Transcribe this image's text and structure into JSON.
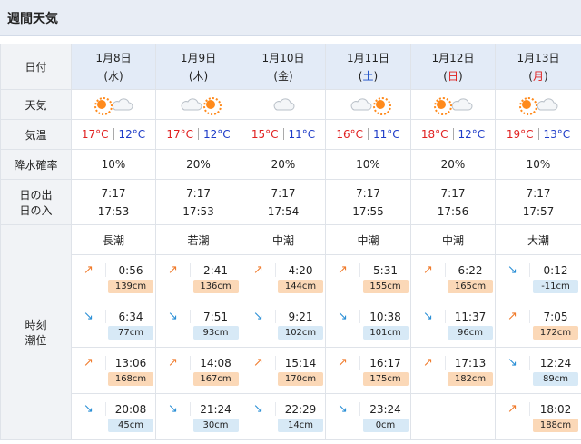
{
  "header": {
    "title": "週間天気"
  },
  "labels": {
    "date": "日付",
    "weather": "天気",
    "temperature": "気温",
    "precip": "降水確率",
    "sunrise": "日の出",
    "sunset": "日の入",
    "tide_time": "時刻",
    "tide_level": "潮位"
  },
  "colors": {
    "high_temp": "#e02020",
    "low_temp": "#1e3cc8",
    "rising": "#f07a2a",
    "falling": "#2a8fd6"
  },
  "days": [
    {
      "date": "1月8日",
      "weekday": "(水)",
      "weekday_type": "weekday",
      "icons": [
        "sun-icon",
        "cloud-icon"
      ],
      "high": "17°C",
      "low": "12°C",
      "precip": "10%",
      "sunrise": "7:17",
      "sunset": "17:53",
      "tide_name": "長潮",
      "tides": [
        {
          "dir": "up",
          "arrow": "↗",
          "time": "0:56",
          "level": "139cm"
        },
        {
          "dir": "down",
          "arrow": "↘",
          "time": "6:34",
          "level": "77cm"
        },
        {
          "dir": "up",
          "arrow": "↗",
          "time": "13:06",
          "level": "168cm"
        },
        {
          "dir": "down",
          "arrow": "↘",
          "time": "20:08",
          "level": "45cm"
        }
      ]
    },
    {
      "date": "1月9日",
      "weekday": "(木)",
      "weekday_type": "weekday",
      "icons": [
        "cloud-icon",
        "sun-icon"
      ],
      "high": "17°C",
      "low": "12°C",
      "precip": "20%",
      "sunrise": "7:17",
      "sunset": "17:53",
      "tide_name": "若潮",
      "tides": [
        {
          "dir": "up",
          "arrow": "↗",
          "time": "2:41",
          "level": "136cm"
        },
        {
          "dir": "down",
          "arrow": "↘",
          "time": "7:51",
          "level": "93cm"
        },
        {
          "dir": "up",
          "arrow": "↗",
          "time": "14:08",
          "level": "167cm"
        },
        {
          "dir": "down",
          "arrow": "↘",
          "time": "21:24",
          "level": "30cm"
        }
      ]
    },
    {
      "date": "1月10日",
      "weekday": "(金)",
      "weekday_type": "weekday",
      "icons": [
        "cloud-icon"
      ],
      "high": "15°C",
      "low": "11°C",
      "precip": "20%",
      "sunrise": "7:17",
      "sunset": "17:54",
      "tide_name": "中潮",
      "tides": [
        {
          "dir": "up",
          "arrow": "↗",
          "time": "4:20",
          "level": "144cm"
        },
        {
          "dir": "down",
          "arrow": "↘",
          "time": "9:21",
          "level": "102cm"
        },
        {
          "dir": "up",
          "arrow": "↗",
          "time": "15:14",
          "level": "170cm"
        },
        {
          "dir": "down",
          "arrow": "↘",
          "time": "22:29",
          "level": "14cm"
        }
      ]
    },
    {
      "date": "1月11日",
      "weekday": "(土)",
      "weekday_type": "sat",
      "icons": [
        "cloud-icon",
        "sun-icon"
      ],
      "high": "16°C",
      "low": "11°C",
      "precip": "10%",
      "sunrise": "7:17",
      "sunset": "17:55",
      "tide_name": "中潮",
      "tides": [
        {
          "dir": "up",
          "arrow": "↗",
          "time": "5:31",
          "level": "155cm"
        },
        {
          "dir": "down",
          "arrow": "↘",
          "time": "10:38",
          "level": "101cm"
        },
        {
          "dir": "up",
          "arrow": "↗",
          "time": "16:17",
          "level": "175cm"
        },
        {
          "dir": "down",
          "arrow": "↘",
          "time": "23:24",
          "level": "0cm"
        }
      ]
    },
    {
      "date": "1月12日",
      "weekday": "(日)",
      "weekday_type": "sun",
      "icons": [
        "sun-icon",
        "cloud-icon"
      ],
      "high": "18°C",
      "low": "12°C",
      "precip": "20%",
      "sunrise": "7:17",
      "sunset": "17:56",
      "tide_name": "中潮",
      "tides": [
        {
          "dir": "up",
          "arrow": "↗",
          "time": "6:22",
          "level": "165cm"
        },
        {
          "dir": "down",
          "arrow": "↘",
          "time": "11:37",
          "level": "96cm"
        },
        {
          "dir": "up",
          "arrow": "↗",
          "time": "17:13",
          "level": "182cm"
        },
        {
          "dir": "",
          "arrow": "",
          "time": "",
          "level": ""
        }
      ]
    },
    {
      "date": "1月13日",
      "weekday": "(月)",
      "weekday_type": "sun",
      "icons": [
        "sun-icon",
        "cloud-icon"
      ],
      "high": "19°C",
      "low": "13°C",
      "precip": "10%",
      "sunrise": "7:17",
      "sunset": "17:57",
      "tide_name": "大潮",
      "tides": [
        {
          "dir": "down",
          "arrow": "↘",
          "time": "0:12",
          "level": "-11cm"
        },
        {
          "dir": "up",
          "arrow": "↗",
          "time": "7:05",
          "level": "172cm"
        },
        {
          "dir": "down",
          "arrow": "↘",
          "time": "12:24",
          "level": "89cm"
        },
        {
          "dir": "up",
          "arrow": "↗",
          "time": "18:02",
          "level": "188cm"
        }
      ]
    }
  ]
}
